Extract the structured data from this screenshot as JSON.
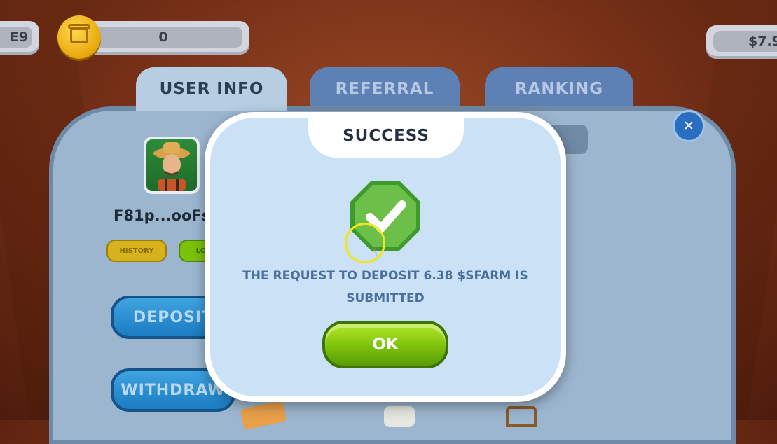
{
  "hud": {
    "left_partial": "E9",
    "coin_balance": "0",
    "right_partial": "$7.9"
  },
  "tabs": [
    {
      "label": "USER INFO",
      "active": true
    },
    {
      "label": "REFERRAL",
      "active": false
    },
    {
      "label": "RANKING",
      "active": false
    }
  ],
  "user": {
    "name": "F81p...ooFs",
    "history_label": "HISTORY",
    "second_label_partial": "LO"
  },
  "actions": {
    "deposit_label": "DEPOSIT",
    "withdraw_label": "WITHDRAW"
  },
  "modal": {
    "title": "SUCCESS",
    "message_line1": "THE REQUEST TO DEPOSIT 6.38 $SFARM IS",
    "message_line2": "SUBMITTED",
    "ok_label": "OK"
  },
  "colors": {
    "accent_green": "#7cc20a",
    "modal_bg": "#cbe2f6",
    "tab_active": "#b6cde2",
    "tab_inactive": "#5d81b5"
  }
}
